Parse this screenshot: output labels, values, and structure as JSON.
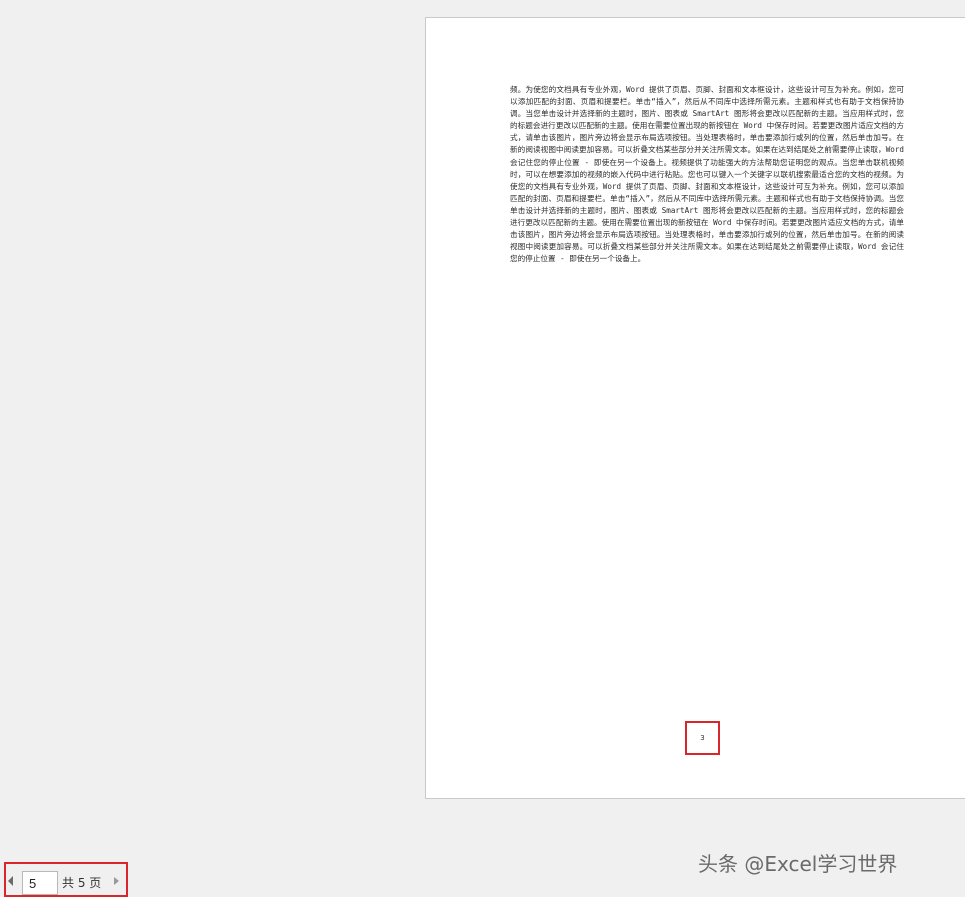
{
  "document": {
    "paragraph": "频。为使您的文档具有专业外观，Word 提供了页眉、页脚、封面和文本框设计，这些设计可互为补充。例如，您可以添加匹配的封面、页眉和提要栏。单击“插入”，然后从不同库中选择所需元素。主题和样式也有助于文档保持协调。当您单击设计并选择新的主题时，图片、图表或 SmartArt 图形将会更改以匹配新的主题。当应用样式时，您的标题会进行更改以匹配新的主题。使用在需要位置出现的新按钮在 Word 中保存时间。若要更改图片适应文档的方式，请单击该图片，图片旁边将会显示布局选项按钮。当处理表格时，单击要添加行或列的位置，然后单击加号。在新的阅读视图中阅读更加容易。可以折叠文档某些部分并关注所需文本。如果在达到结尾处之前需要停止读取，Word 会记住您的停止位置 - 即使在另一个设备上。视频提供了功能强大的方法帮助您证明您的观点。当您单击联机视频时，可以在想要添加的视频的嵌入代码中进行粘贴。您也可以键入一个关键字以联机搜索最适合您的文档的视频。为使您的文档具有专业外观，Word 提供了页眉、页脚、封面和文本框设计，这些设计可互为补充。例如，您可以添加匹配的封面、页眉和提要栏。单击“插入”，然后从不同库中选择所需元素。主题和样式也有助于文档保持协调。当您单击设计并选择新的主题时，图片、图表或 SmartArt 图形将会更改以匹配新的主题。当应用样式时，您的标题会进行更改以匹配新的主题。使用在需要位置出现的新按钮在 Word 中保存时间。若要更改图片适应文档的方式，请单击该图片，图片旁边将会显示布局选项按钮。当处理表格时，单击要添加行或列的位置，然后单击加号。在新的阅读视图中阅读更加容易。可以折叠文档某些部分并关注所需文本。如果在达到结尾处之前需要停止读取，Word 会记住您的停止位置 - 即使在另一个设备上。",
    "page_number": "3"
  },
  "navigation": {
    "current_page": "5",
    "total_label": "共 5 页",
    "prev_icon": "triangle-left-icon",
    "next_icon": "triangle-right-icon"
  },
  "watermark": {
    "text": "头条 @Excel学习世界"
  },
  "colors": {
    "background": "#f0f0f0",
    "page": "#ffffff",
    "highlight": "#d9262b"
  }
}
